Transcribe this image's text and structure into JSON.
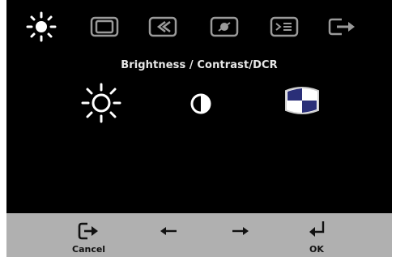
{
  "top_menu": {
    "items": [
      {
        "icon": "brightness-icon",
        "selected": true
      },
      {
        "icon": "image-position-icon",
        "selected": false
      },
      {
        "icon": "image-setup-icon",
        "selected": false
      },
      {
        "icon": "image-properties-icon",
        "selected": false
      },
      {
        "icon": "options-icon",
        "selected": false
      },
      {
        "icon": "exit-icon",
        "selected": false
      }
    ]
  },
  "submenu": {
    "title": "Brightness / Contrast/DCR",
    "items": [
      {
        "icon": "brightness-sun-icon"
      },
      {
        "icon": "contrast-icon"
      },
      {
        "icon": "dcr-icon"
      }
    ]
  },
  "nav": {
    "cancel_label": "Cancel",
    "ok_label": "OK"
  },
  "colors": {
    "osd_background": "#000000",
    "bottom_bar": "#b0b0b0",
    "icon_light": "#ffffff",
    "icon_gray": "#9a9a9a",
    "dcr_blue": "#2a2f78"
  }
}
